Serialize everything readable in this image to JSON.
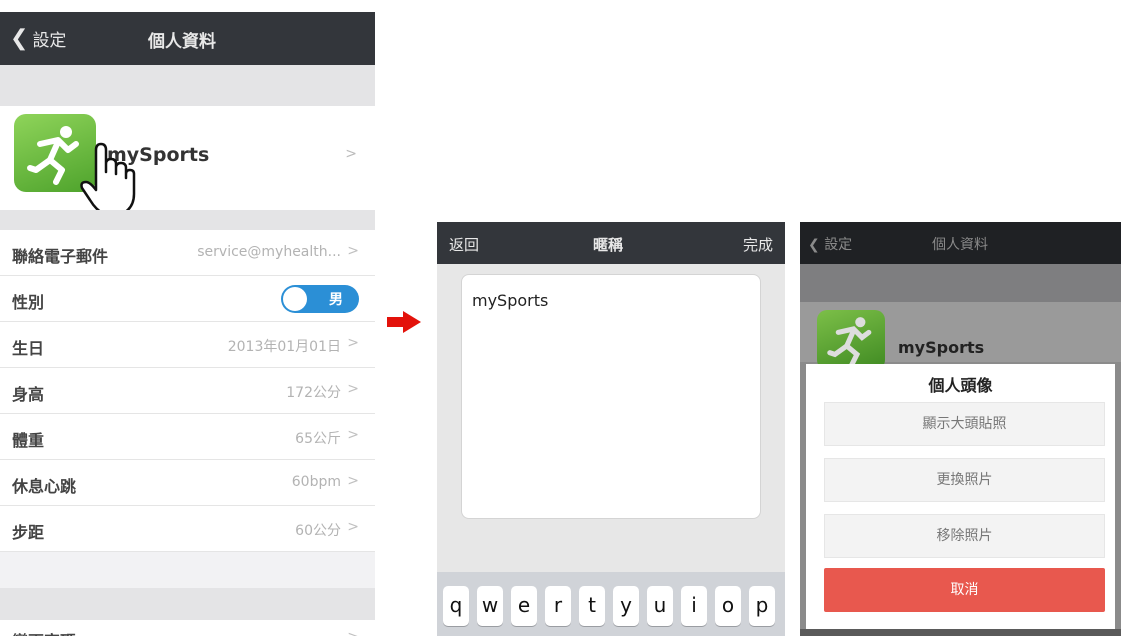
{
  "screen1": {
    "nav": {
      "back_label": "設定",
      "title": "個人資料"
    },
    "profile": {
      "name": "mySports"
    },
    "rows": [
      {
        "label": "聯絡電子郵件",
        "value": "service@myhealth..."
      },
      {
        "label": "性別",
        "toggle": "男"
      },
      {
        "label": "生日",
        "value": "2013年01月01日"
      },
      {
        "label": "身高",
        "value": "172公分"
      },
      {
        "label": "體重",
        "value": "65公斤"
      },
      {
        "label": "休息心跳",
        "value": "60bpm"
      },
      {
        "label": "步距",
        "value": "60公分"
      }
    ],
    "bottom_row": {
      "label": "變更密碼"
    },
    "chevron": ">"
  },
  "screen2": {
    "nav": {
      "back": "返回",
      "title": "暱稱",
      "done": "完成"
    },
    "input_value": "mySports",
    "keys": [
      "q",
      "w",
      "e",
      "r",
      "t",
      "y",
      "u",
      "i",
      "o",
      "p"
    ]
  },
  "screen3": {
    "nav": {
      "back_label": "設定",
      "title": "個人資料"
    },
    "profile_name": "mySports",
    "sheet": {
      "title": "個人頭像",
      "options": [
        "顯示大頭貼照",
        "更換照片",
        "移除照片"
      ],
      "cancel": "取消"
    }
  },
  "colors": {
    "navbar": "#33363b",
    "accent_blue": "#2b8fd6",
    "cancel_red": "#e8584e",
    "arrow_red": "#e3120b"
  }
}
